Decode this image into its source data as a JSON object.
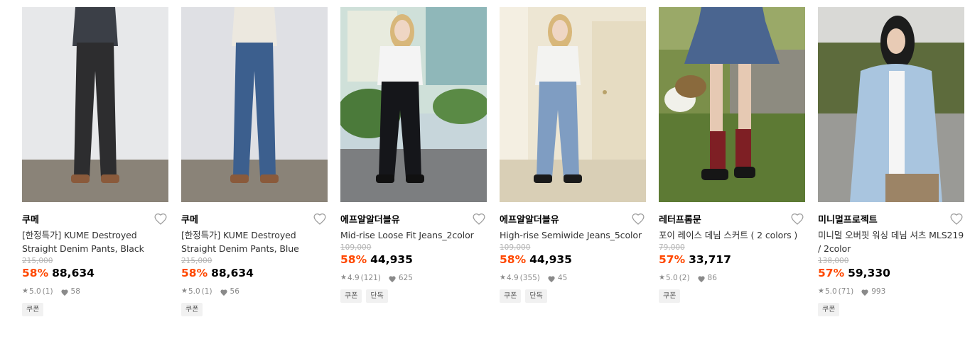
{
  "products": [
    {
      "brand": "쿠메",
      "title": "[한정특가] KUME Destroyed Straight Denim Pants, Black",
      "original_price": "215,000",
      "discount": "58%",
      "price": "88,634",
      "rating": "5.0",
      "reviews": "(1)",
      "likes": "58",
      "tags": [
        "쿠폰"
      ],
      "image": "model-black-jeans-photo",
      "colors": {
        "bg": "#e7e8ea",
        "floor": "#8a8378",
        "pants": "#2d2d2f",
        "top": "#3b3f47",
        "shoes": "#8a5a3b"
      }
    },
    {
      "brand": "쿠메",
      "title": "[한정특가] KUME Destroyed Straight Denim Pants, Blue",
      "original_price": "215,000",
      "discount": "58%",
      "price": "88,634",
      "rating": "5.0",
      "reviews": "(1)",
      "likes": "56",
      "tags": [
        "쿠폰"
      ],
      "image": "model-blue-jeans-photo",
      "colors": {
        "bg": "#dfe0e4",
        "floor": "#8a8378",
        "pants": "#3c5f8e",
        "top": "#ece8df",
        "shoes": "#8a5a3b"
      }
    },
    {
      "brand": "에프알알더블유",
      "title": "Mid-rise Loose Fit Jeans_2color",
      "original_price": "109,000",
      "discount": "58%",
      "price": "44,935",
      "rating": "4.9",
      "reviews": "(121)",
      "likes": "625",
      "tags": [
        "쿠폰",
        "단독"
      ],
      "image": "model-outdoor-black-jeans-photo",
      "colors": {
        "bg": "#c7d6db",
        "floor": "#7c7e80",
        "pants": "#15161a",
        "top": "#f4f4f4",
        "shoes": "#111111"
      }
    },
    {
      "brand": "에프알알더블유",
      "title": "High-rise Semiwide Jeans_5color",
      "original_price": "109,000",
      "discount": "58%",
      "price": "44,935",
      "rating": "4.9",
      "reviews": "(355)",
      "likes": "45",
      "tags": [
        "쿠폰",
        "단독"
      ],
      "image": "model-indoor-light-jeans-photo",
      "colors": {
        "bg": "#ede6d3",
        "floor": "#d9cfb6",
        "pants": "#7f9dc2",
        "top": "#f3f3f1",
        "shoes": "#1a1a1a"
      }
    },
    {
      "brand": "레터프롬문",
      "title": "포이 레이스 데님 스커트 ( 2 colors )",
      "original_price": "79,000",
      "discount": "57%",
      "price": "33,717",
      "rating": "5.0",
      "reviews": "(2)",
      "likes": "86",
      "tags": [
        "쿠폰"
      ],
      "image": "model-denim-skirt-photo",
      "colors": {
        "bg": "#7b8f4a",
        "floor": "#5d7a34",
        "pants": "#4a6590",
        "top": "#354a6e",
        "shoes": "#161616"
      }
    },
    {
      "brand": "미니멀프로젝트",
      "title": "미니멀 오버핏 워싱 데님 셔츠 MLS219 / 2color",
      "original_price": "138,000",
      "discount": "57%",
      "price": "59,330",
      "rating": "5.0",
      "reviews": "(71)",
      "likes": "993",
      "tags": [
        "쿠폰"
      ],
      "image": "model-denim-shirt-photo",
      "colors": {
        "bg": "#5d6b3c",
        "floor": "#8e8e8a",
        "pants": "#9c8466",
        "top": "#a9c5df",
        "shoes": "#222222"
      }
    }
  ]
}
